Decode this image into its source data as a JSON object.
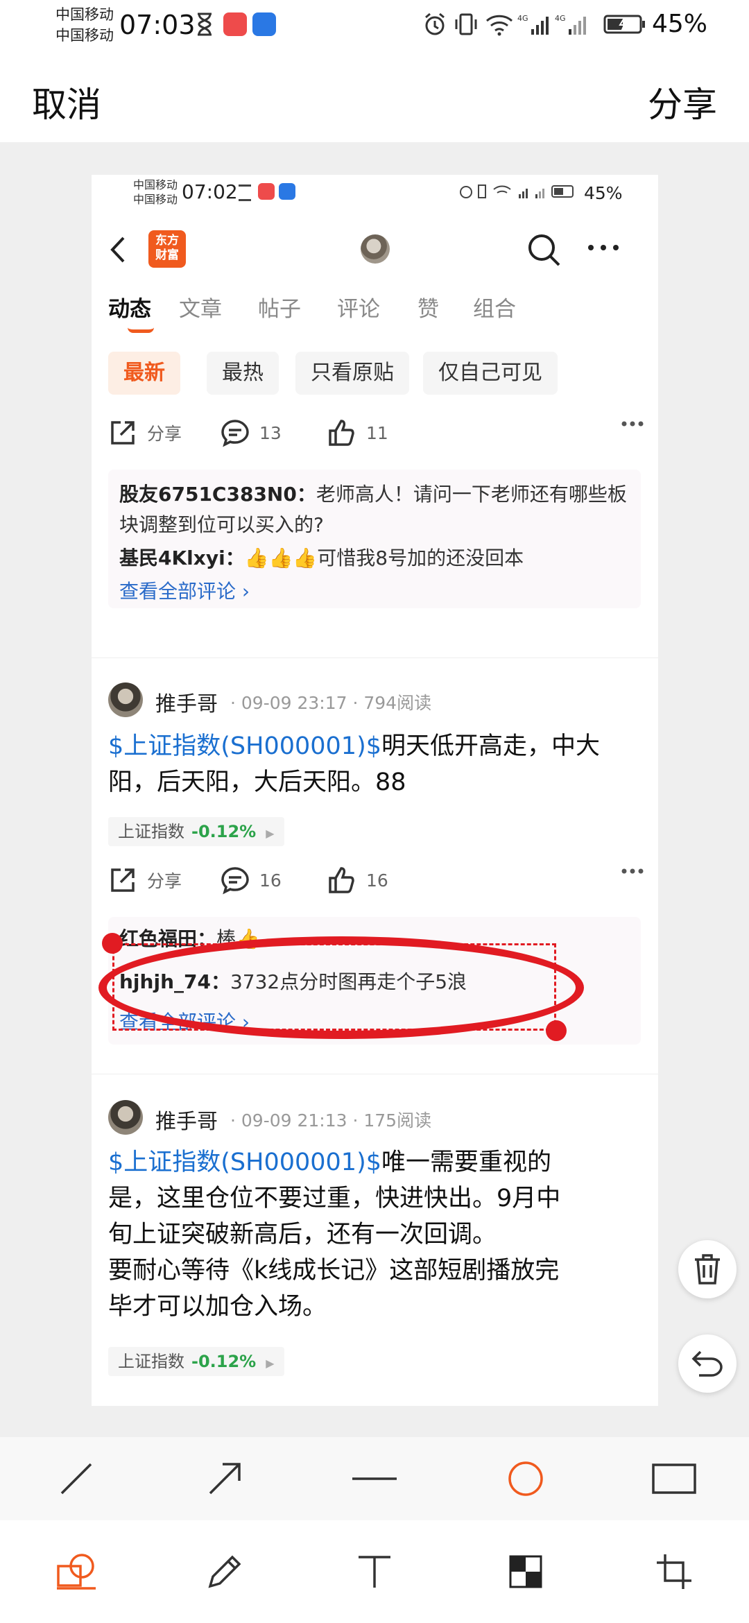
{
  "status": {
    "carrier": [
      "中国移动",
      "中国移动"
    ],
    "time": "07:03",
    "signal1": "4G",
    "signal2": "4G",
    "battery": "45%"
  },
  "header": {
    "cancel": "取消",
    "share": "分享"
  },
  "inner": {
    "status": {
      "carrier": [
        "中国移动",
        "中国移动"
      ],
      "time": "07:02",
      "battery": "45%"
    },
    "nav": {
      "logo_line1": "东方",
      "logo_line2": "财富"
    },
    "tabs": [
      "动态",
      "文章",
      "帖子",
      "评论",
      "赞",
      "组合"
    ],
    "chips": [
      "最新",
      "最热",
      "只看原贴",
      "仅自己可见"
    ],
    "post1": {
      "share": "分享",
      "comments": "13",
      "likes": "11",
      "comments_list": [
        {
          "who": "股友6751C383N0：",
          "text": "老师高人！请问一下老师还有哪些板块调整到位可以买入的?"
        },
        {
          "who": "基民4Klxyi：",
          "text": "👍👍👍可惜我8号加的还没回本"
        }
      ],
      "see_all": "查看全部评论 ›"
    },
    "post2": {
      "name": "推手哥",
      "meta": "· 09-09 23:17 · 794阅读",
      "tag": "$上证指数(SH000001)$",
      "text": "明天低开高走，中大阳，后天阳，大后天阳。88",
      "stock": "上证指数",
      "stock_pct": "-0.12%",
      "share": "分享",
      "comments": "16",
      "likes": "16",
      "comments_list": [
        {
          "who": "红色福田：",
          "text": "棒👍"
        },
        {
          "who": "hjhjh_74：",
          "text": "3732点分时图再走个子5浪"
        }
      ],
      "see_all": "查看全部评论 ›"
    },
    "post3": {
      "name": "推手哥",
      "meta": "· 09-09 21:13 · 175阅读",
      "tag": "$上证指数(SH000001)$",
      "text_first": "唯一需要重视的",
      "lines": [
        "是，这里仓位不要过重，快进快出。9月中",
        "旬上证突破新高后，还有一次回调。",
        "要耐心等待《k线成长记》这部短剧播放完",
        "毕才可以加仓入场。"
      ],
      "stock": "上证指数",
      "stock_pct": "-0.12%"
    }
  },
  "colors": {
    "accent": "#f05a1e",
    "annotation": "#e11b22",
    "link": "#1a6fd0",
    "down": "#2ca34a"
  },
  "icons": [
    "line-tool-icon",
    "arrow-tool-icon",
    "hline-tool-icon",
    "circle-tool-icon",
    "rect-tool-icon",
    "shape-tool-icon",
    "pen-tool-icon",
    "text-tool-icon",
    "mosaic-tool-icon",
    "crop-tool-icon",
    "delete-icon",
    "undo-icon"
  ]
}
